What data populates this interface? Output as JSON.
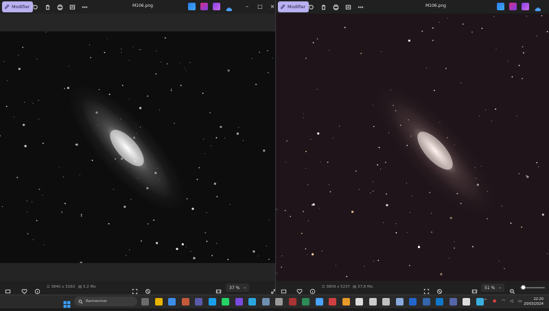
{
  "left": {
    "modifier_label": "Modifier",
    "filename": "M106.png",
    "dimensions": "3840 x 3160",
    "filesize": "5,2 Mo",
    "zoom": "37 %"
  },
  "right": {
    "modifier_label": "Modifier",
    "filename": "M106.png",
    "dimensions": "3809 x 5237",
    "filesize": "37,8 Mo",
    "zoom": "51 %"
  },
  "taskbar": {
    "search_placeholder": "Rechercher",
    "time": "22:20",
    "date": "20/03/2024"
  },
  "colors": {
    "accent": "#b9b1f0",
    "left_bg": "#0d0d0d",
    "right_bg": "#1e1419"
  },
  "icons": [
    "pencil-icon",
    "rotate-icon",
    "trash-icon",
    "print-icon",
    "enhance-icon",
    "more-icon",
    "heart-icon",
    "info-icon",
    "search-icon",
    "windows-icon"
  ]
}
